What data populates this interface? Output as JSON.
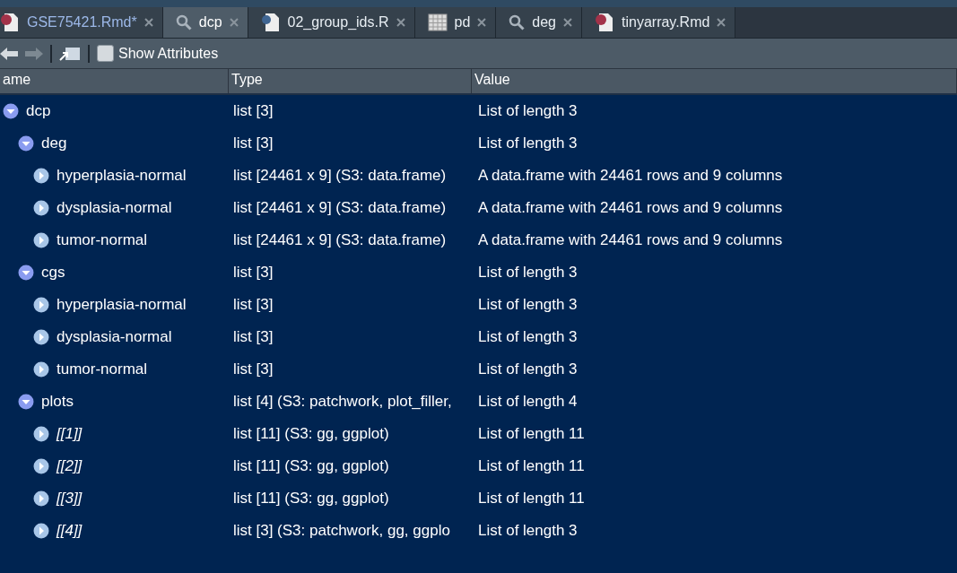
{
  "tabs": [
    {
      "label": "GSE75421.Rmd*",
      "kind": "rmd",
      "selected": false
    },
    {
      "label": "dcp",
      "kind": "search",
      "selected": true
    },
    {
      "label": "02_group_ids.R",
      "kind": "r",
      "selected": false
    },
    {
      "label": "pd",
      "kind": "table",
      "selected": false
    },
    {
      "label": "deg",
      "kind": "search",
      "selected": false
    },
    {
      "label": "tinyarray.Rmd",
      "kind": "rmd",
      "selected": false
    }
  ],
  "toolbar": {
    "show_attributes": {
      "label": "Show Attributes",
      "checked": false
    }
  },
  "table": {
    "columns": [
      "ame",
      "Type",
      "Value"
    ],
    "rows": [
      {
        "name": "dcp",
        "type": "list [3]",
        "value": "List of length 3",
        "expanded": true,
        "children": [
          {
            "name": "deg",
            "type": "list [3]",
            "value": "List of length 3",
            "expanded": true,
            "children": [
              {
                "name": "hyperplasia-normal",
                "type": "list [24461 x 9] (S3: data.frame)",
                "value": "A data.frame with 24461 rows and 9 columns",
                "expanded": false
              },
              {
                "name": "dysplasia-normal",
                "type": "list [24461 x 9] (S3: data.frame)",
                "value": "A data.frame with 24461 rows and 9 columns",
                "expanded": false
              },
              {
                "name": "tumor-normal",
                "type": "list [24461 x 9] (S3: data.frame)",
                "value": "A data.frame with 24461 rows and 9 columns",
                "expanded": false
              }
            ]
          },
          {
            "name": "cgs",
            "type": "list [3]",
            "value": "List of length 3",
            "expanded": true,
            "children": [
              {
                "name": "hyperplasia-normal",
                "type": "list [3]",
                "value": "List of length 3",
                "expanded": false
              },
              {
                "name": "dysplasia-normal",
                "type": "list [3]",
                "value": "List of length 3",
                "expanded": false
              },
              {
                "name": "tumor-normal",
                "type": "list [3]",
                "value": "List of length 3",
                "expanded": false
              }
            ]
          },
          {
            "name": "plots",
            "type": "list [4] (S3: patchwork, plot_filler,",
            "value": "List of length 4",
            "expanded": true,
            "children": [
              {
                "name": "[[1]]",
                "kind": "index",
                "type": "list [11] (S3: gg, ggplot)",
                "value": "List of length 11",
                "expanded": false
              },
              {
                "name": "[[2]]",
                "kind": "index",
                "type": "list [11] (S3: gg, ggplot)",
                "value": "List of length 11",
                "expanded": false
              },
              {
                "name": "[[3]]",
                "kind": "index",
                "type": "list [11] (S3: gg, ggplot)",
                "value": "List of length 11",
                "expanded": false
              },
              {
                "name": "[[4]]",
                "kind": "index",
                "type": "list [3] (S3: patchwork, gg, ggplo",
                "value": "List of length 3",
                "expanded": false
              }
            ]
          }
        ]
      }
    ]
  }
}
